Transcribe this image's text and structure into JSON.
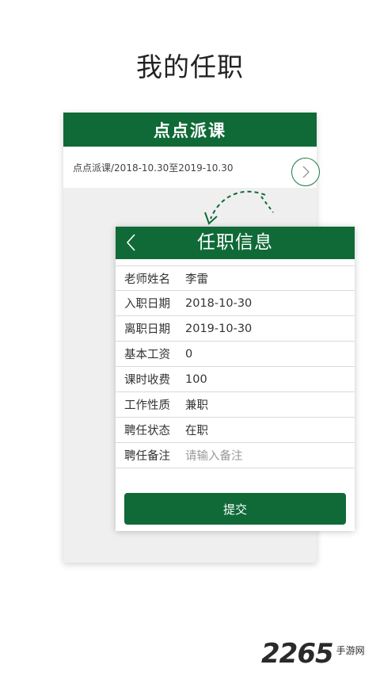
{
  "page_title": "我的任职",
  "back_card": {
    "header": "点点派课",
    "row_text": "点点派课/2018-10.30至2019-10.30"
  },
  "front_card": {
    "title": "任职信息",
    "fields": [
      {
        "label": "老师姓名",
        "value": "李雷"
      },
      {
        "label": "入职日期",
        "value": "2018-10-30"
      },
      {
        "label": "离职日期",
        "value": "2019-10-30"
      },
      {
        "label": "基本工资",
        "value": "0"
      },
      {
        "label": "课时收费",
        "value": "100"
      },
      {
        "label": "工作性质",
        "value": "兼职"
      },
      {
        "label": "聘任状态",
        "value": "在职"
      },
      {
        "label": "聘任备注",
        "placeholder": "请输入备注"
      }
    ],
    "submit_label": "提交"
  },
  "watermark": {
    "number": "2265",
    "text": "手游网"
  },
  "colors": {
    "accent": "#0f6a37",
    "background": "#efefef"
  },
  "icons": [
    "chevron-right-icon",
    "chevron-left-icon",
    "dashed-arrow-icon"
  ]
}
